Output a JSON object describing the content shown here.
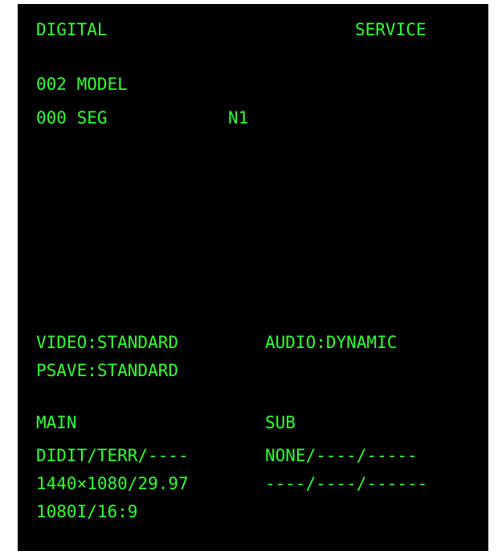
{
  "header": {
    "left": "DIGITAL",
    "right": "SERVICE"
  },
  "info": {
    "model": "002 MODEL",
    "seg": "000 SEG",
    "seg_value": "N1"
  },
  "settings": {
    "video": "VIDEO:STANDARD",
    "audio": "AUDIO:DYNAMIC",
    "psave": "PSAVE:STANDARD"
  },
  "signal": {
    "main_label": "MAIN",
    "sub_label": "SUB",
    "main_source": "DIDIT/TERR/----",
    "sub_source": "NONE/----/-----",
    "main_resolution": "1440×1080/29.97",
    "sub_resolution": "----/----/------",
    "main_format": "1080I/16:9"
  },
  "colors": {
    "background": "#000000",
    "text": "#33ff33",
    "frame": "#ffffff"
  }
}
